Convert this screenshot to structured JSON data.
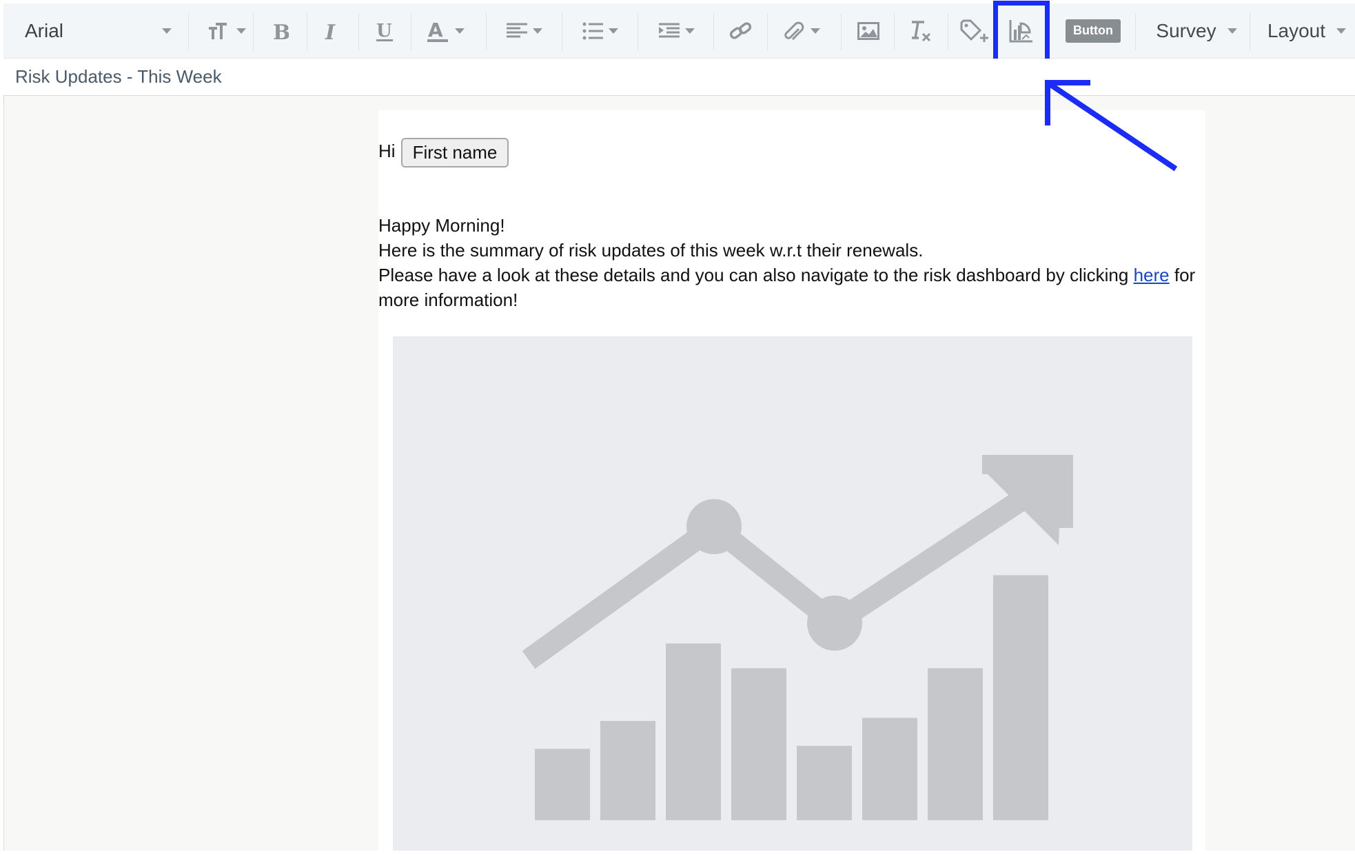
{
  "toolbar": {
    "font_family": "Arial",
    "button_chip_label": "Button",
    "survey_label": "Survey",
    "layout_label": "Layout",
    "icons": [
      "text-size-icon",
      "bold-icon",
      "italic-icon",
      "underline-icon",
      "text-color-icon",
      "align-icon",
      "list-icon",
      "indent-icon",
      "link-icon",
      "attachment-icon",
      "image-icon",
      "clear-format-icon",
      "tag-add-icon",
      "chart-icon"
    ],
    "highlight_color": "#1a2cf5"
  },
  "subject": {
    "text": "Risk Updates - This Week"
  },
  "email": {
    "greeting": "Hi",
    "token_label": "First name",
    "line1": "Happy Morning!",
    "line2": "Here is the summary of risk updates of this week w.r.t their renewals.",
    "line3_before": "Please have a look at these details and you can also navigate to the risk dashboard by clicking ",
    "link_text": "here",
    "line3_after": " for more information!"
  },
  "annotation": {
    "arrow_color": "#1a2cf5"
  },
  "chart_placeholder": {
    "icon": "chart-placeholder-icon",
    "bar_fill": "#c6c7cb",
    "bar_levels": [
      0.23,
      0.32,
      0.57,
      0.49,
      0.24,
      0.33,
      0.49,
      0.79
    ]
  }
}
